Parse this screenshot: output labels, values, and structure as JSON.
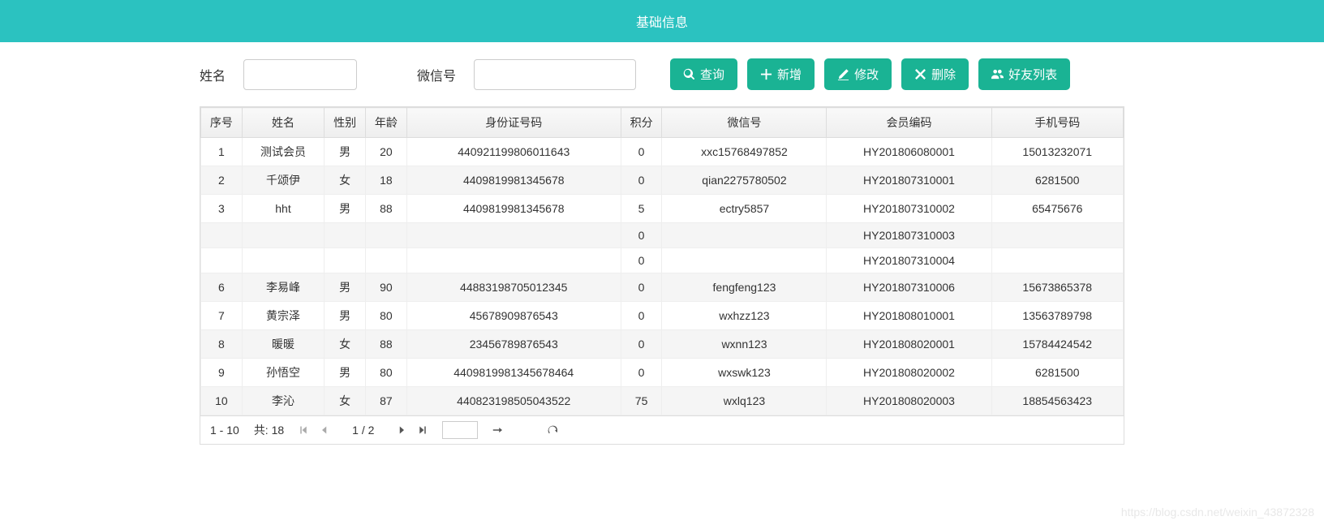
{
  "header": {
    "title": "基础信息"
  },
  "search": {
    "name_label": "姓名",
    "wechat_label": "微信号",
    "name_value": "",
    "wechat_value": ""
  },
  "buttons": {
    "query": "查询",
    "add": "新增",
    "edit": "修改",
    "delete": "删除",
    "friends": "好友列表"
  },
  "table": {
    "headers": [
      "序号",
      "姓名",
      "性别",
      "年龄",
      "身份证号码",
      "积分",
      "微信号",
      "会员编码",
      "手机号码"
    ],
    "rows": [
      [
        "1",
        "测试会员",
        "男",
        "20",
        "440921199806011643",
        "0",
        "xxc15768497852",
        "HY201806080001",
        "15013232071"
      ],
      [
        "2",
        "千颂伊",
        "女",
        "18",
        "4409819981345678",
        "0",
        "qian2275780502",
        "HY201807310001",
        "6281500"
      ],
      [
        "3",
        "hht",
        "男",
        "88",
        "4409819981345678",
        "5",
        "ectry5857",
        "HY201807310002",
        "65475676"
      ],
      [
        "",
        "",
        "",
        "",
        "",
        "0",
        "",
        "HY201807310003",
        ""
      ],
      [
        "",
        "",
        "",
        "",
        "",
        "0",
        "",
        "HY201807310004",
        ""
      ],
      [
        "6",
        "李易峰",
        "男",
        "90",
        "44883198705012345",
        "0",
        "fengfeng123",
        "HY201807310006",
        "15673865378"
      ],
      [
        "7",
        "黄宗泽",
        "男",
        "80",
        "45678909876543",
        "0",
        "wxhzz123",
        "HY201808010001",
        "13563789798"
      ],
      [
        "8",
        "暖暖",
        "女",
        "88",
        "23456789876543",
        "0",
        "wxnn123",
        "HY201808020001",
        "15784424542"
      ],
      [
        "9",
        "孙悟空",
        "男",
        "80",
        "4409819981345678464",
        "0",
        "wxswk123",
        "HY201808020002",
        "6281500"
      ],
      [
        "10",
        "李沁",
        "女",
        "87",
        "440823198505043522",
        "75",
        "wxlq123",
        "HY201808020003",
        "18854563423"
      ]
    ]
  },
  "pager": {
    "range": "1 - 10",
    "total": "共: 18",
    "page": "1 / 2"
  },
  "watermark": "https://blog.csdn.net/weixin_43872328"
}
